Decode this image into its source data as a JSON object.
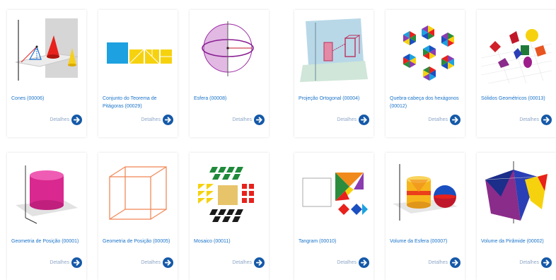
{
  "cards": [
    {
      "title": "Cones (00006)",
      "details_label": "Detalhes",
      "thumbnail_icon": "cones-icon"
    },
    {
      "title": "Conjunto do Teorema de Pitágoras (00029)",
      "details_label": "Detalhes",
      "thumbnail_icon": "pythagorean-theorem-icon"
    },
    {
      "title": "Esfera (00008)",
      "details_label": "Detalhes",
      "thumbnail_icon": "sphere-icon"
    },
    {
      "title": "Projeção Ortogonal (00004)",
      "details_label": "Detalhes",
      "thumbnail_icon": "orthogonal-projection-icon"
    },
    {
      "title": "Quebra-cabeça dos hexágonos (00012)",
      "details_label": "Detalhes",
      "thumbnail_icon": "hexagon-puzzle-icon"
    },
    {
      "title": "Sólidos Geométricos (00013)",
      "details_label": "Detalhes",
      "thumbnail_icon": "geometric-solids-icon"
    },
    {
      "title": "Geometria de Posição (00001)",
      "details_label": "Detalhes",
      "thumbnail_icon": "cylinder-icon"
    },
    {
      "title": "Geometria de Posição (00005)",
      "details_label": "Detalhes",
      "thumbnail_icon": "wireframe-cube-icon"
    },
    {
      "title": "Mosaico (00011)",
      "details_label": "Detalhes",
      "thumbnail_icon": "mosaic-icon"
    },
    {
      "title": "Tangram (00010)",
      "details_label": "Detalhes",
      "thumbnail_icon": "tangram-icon"
    },
    {
      "title": "Volume da Esfera (00007)",
      "details_label": "Detalhes",
      "thumbnail_icon": "sphere-volume-icon"
    },
    {
      "title": "Volume da Pirâmide (00002)",
      "details_label": "Detalhes",
      "thumbnail_icon": "pyramid-volume-icon"
    }
  ],
  "colors": {
    "link": "#1a73c9",
    "details_button": "#1559a8",
    "details_label": "#8fa8c8"
  }
}
